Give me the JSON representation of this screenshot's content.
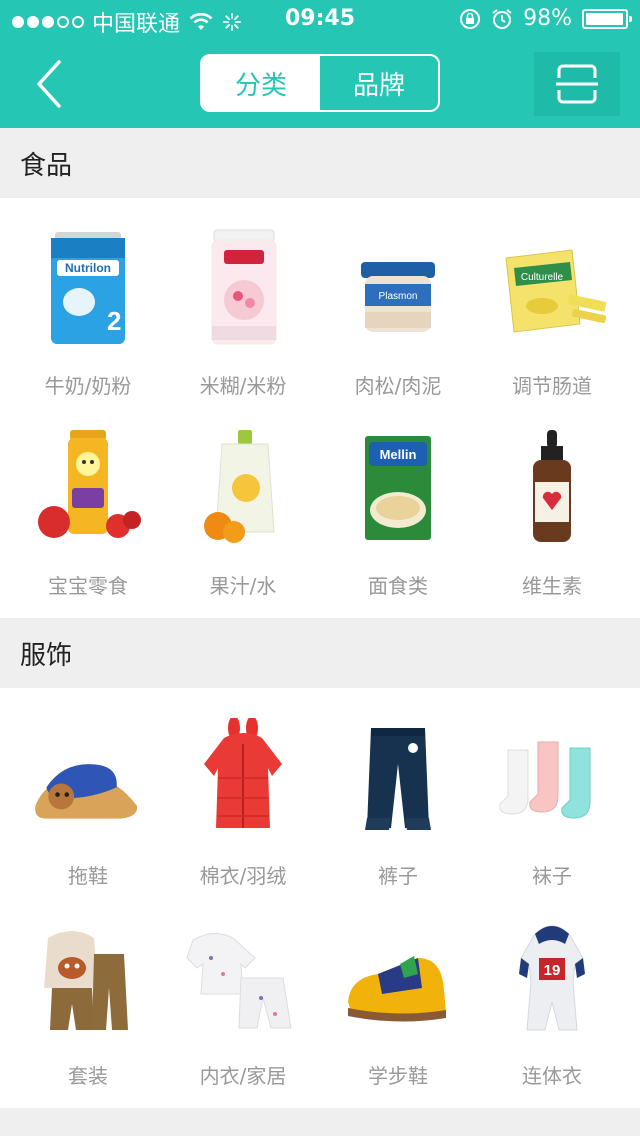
{
  "status_bar": {
    "carrier": "中国联通",
    "time": "09:45",
    "battery": "98%",
    "battery_level": 0.98
  },
  "nav": {
    "back_icon": "chevron-left-icon",
    "tabs": [
      {
        "label": "分类",
        "active": true
      },
      {
        "label": "品牌",
        "active": false
      }
    ],
    "scan_icon": "scan-icon"
  },
  "colors": {
    "brand": "#26c6b4",
    "background": "#efefef",
    "label": "#999999"
  },
  "sections": [
    {
      "title": "食品",
      "items": [
        {
          "label": "牛奶/奶粉",
          "icon": "formula-can-icon"
        },
        {
          "label": "米糊/米粉",
          "icon": "cereal-canister-icon"
        },
        {
          "label": "肉松/肉泥",
          "icon": "baby-food-jar-icon"
        },
        {
          "label": "调节肠道",
          "icon": "probiotic-box-icon"
        },
        {
          "label": "宝宝零食",
          "icon": "snack-puffs-icon"
        },
        {
          "label": "果汁/水",
          "icon": "juice-pouch-icon"
        },
        {
          "label": "面食类",
          "icon": "pasta-box-icon"
        },
        {
          "label": "维生素",
          "icon": "vitamin-dropper-icon"
        }
      ]
    },
    {
      "title": "服饰",
      "items": [
        {
          "label": "拖鞋",
          "icon": "slipper-icon"
        },
        {
          "label": "棉衣/羽绒",
          "icon": "down-jacket-icon"
        },
        {
          "label": "裤子",
          "icon": "pants-icon"
        },
        {
          "label": "袜子",
          "icon": "socks-icon"
        },
        {
          "label": "套装",
          "icon": "outfit-set-icon"
        },
        {
          "label": "内衣/家居",
          "icon": "pajamas-icon"
        },
        {
          "label": "学步鞋",
          "icon": "toddler-shoe-icon"
        },
        {
          "label": "连体衣",
          "icon": "jumpsuit-icon"
        }
      ]
    }
  ]
}
